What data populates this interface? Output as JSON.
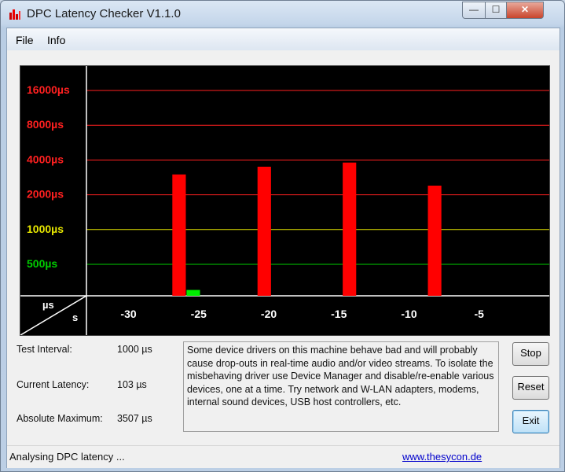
{
  "window": {
    "title": "DPC Latency Checker V1.1.0",
    "min_glyph": "—",
    "max_glyph": "☐",
    "close_glyph": "✕"
  },
  "menu": [
    "File",
    "Info"
  ],
  "chart_data": {
    "type": "bar",
    "y_levels": [
      {
        "label": "16000µs",
        "value": 16000,
        "color": "#ff2020"
      },
      {
        "label": "8000µs",
        "value": 8000,
        "color": "#ff2020"
      },
      {
        "label": "4000µs",
        "value": 4000,
        "color": "#ff2020"
      },
      {
        "label": "2000µs",
        "value": 2000,
        "color": "#ff2020"
      },
      {
        "label": "1000µs",
        "value": 1000,
        "color": "#e6e600"
      },
      {
        "label": "500µs",
        "value": 500,
        "color": "#00cc00"
      }
    ],
    "y_unit": "µs",
    "x_unit": "s",
    "x_ticks": [
      "-30",
      "-25",
      "-20",
      "-15",
      "-10",
      "-5"
    ],
    "x_tick_values": [
      -30,
      -25,
      -20,
      -15,
      -10,
      -5
    ],
    "x_range": [
      -33,
      0
    ],
    "values": [
      170,
      170,
      180,
      200,
      170,
      170,
      3000,
      300,
      170,
      170,
      170,
      170,
      3500,
      170,
      170,
      180,
      170,
      170,
      3800,
      180,
      180,
      180,
      170,
      170,
      2400,
      180,
      170,
      170,
      170,
      230,
      170,
      170
    ],
    "colors": {
      "ok": "#00ee00",
      "warn": "#ff0000"
    }
  },
  "stats": [
    {
      "label": "Test Interval:",
      "value": "1000 µs"
    },
    {
      "label": "Current Latency:",
      "value": "103 µs"
    },
    {
      "label": "Absolute Maximum:",
      "value": "3507 µs"
    }
  ],
  "message": "Some device drivers on this machine behave bad and will probably cause drop-outs in real-time audio and/or video streams. To isolate the misbehaving driver use Device Manager and disable/re-enable various devices, one at a time. Try network and W-LAN adapters, modems, internal sound devices, USB host controllers, etc.",
  "buttons": {
    "stop": "Stop",
    "reset": "Reset",
    "exit": "Exit"
  },
  "status": {
    "text": "Analysing DPC latency ...",
    "link": "www.thesycon.de"
  }
}
